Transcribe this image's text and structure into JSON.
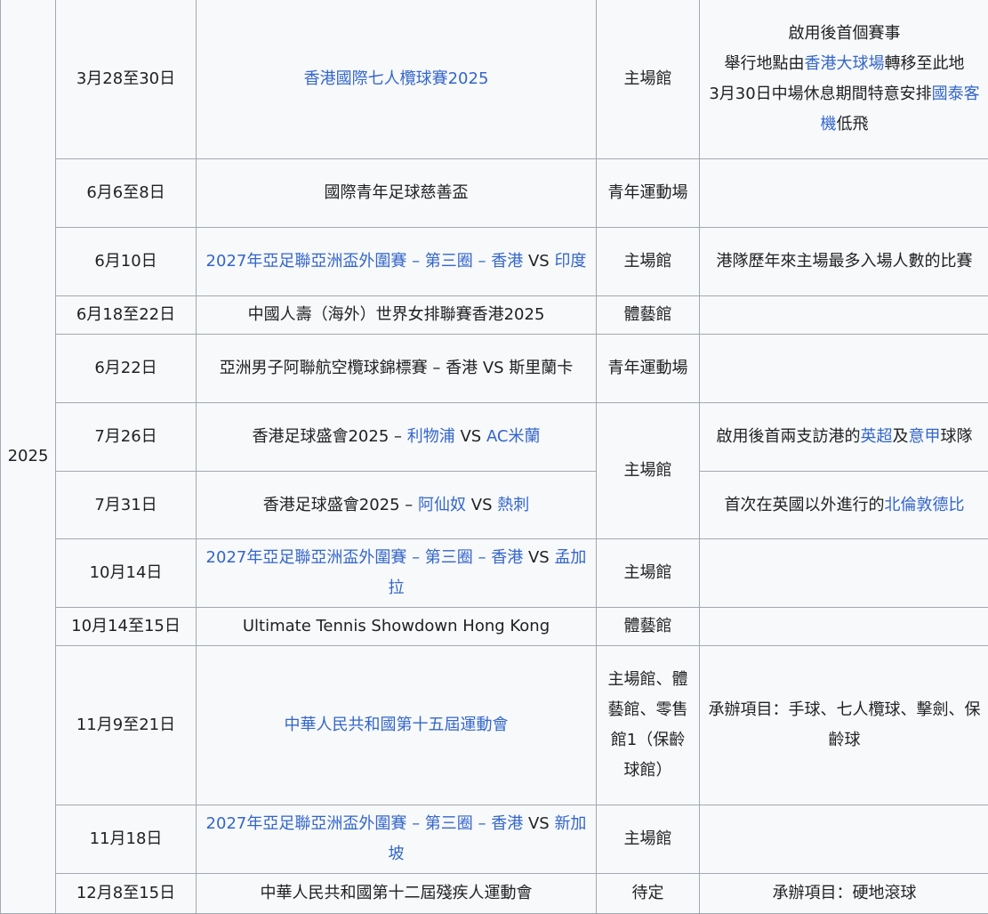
{
  "year": "2025",
  "rows": [
    {
      "date": "3月28至30日",
      "event": [
        {
          "t": "香港國際七人欖球賽2025",
          "link": true
        }
      ],
      "venue": "主場館",
      "notes": [
        {
          "t": "啟用後首個賽事",
          "link": false
        },
        {
          "t": "",
          "br": true
        },
        {
          "t": "舉行地點由",
          "link": false
        },
        {
          "t": "香港大球場",
          "link": true
        },
        {
          "t": "轉移至此地",
          "link": false
        },
        {
          "t": "",
          "br": true
        },
        {
          "t": "3月30日中場休息期間特意安排",
          "link": false
        },
        {
          "t": "國泰客機",
          "link": true
        },
        {
          "t": "低飛",
          "link": false
        }
      ]
    },
    {
      "date": "6月6至8日",
      "event": [
        {
          "t": "國際青年足球慈善盃",
          "link": false
        }
      ],
      "venue": "青年運動場",
      "notes": []
    },
    {
      "date": "6月10日",
      "event": [
        {
          "t": "2027年亞足聯亞洲盃外圍賽 – 第三圈 – 香港",
          "link": true
        },
        {
          "t": " VS ",
          "link": false
        },
        {
          "t": "印度",
          "link": true
        }
      ],
      "venue": "主場館",
      "notes": [
        {
          "t": "港隊歷年來主場最多入場人數的比賽",
          "link": false
        }
      ]
    },
    {
      "date": "6月18至22日",
      "event": [
        {
          "t": "中國人壽（海外）世界女排聯賽香港2025",
          "link": false
        }
      ],
      "venue": "體藝館",
      "notes": []
    },
    {
      "date": "6月22日",
      "event": [
        {
          "t": "亞洲男子阿聯航空欖球錦標賽 – 香港 VS 斯里蘭卡",
          "link": false
        }
      ],
      "venue": "青年運動場",
      "notes": []
    },
    {
      "date": "7月26日",
      "event": [
        {
          "t": "香港足球盛會2025 – ",
          "link": false
        },
        {
          "t": "利物浦",
          "link": true
        },
        {
          "t": " VS ",
          "link": false
        },
        {
          "t": "AC米蘭",
          "link": true
        }
      ],
      "venue": "主場館",
      "notes": [
        {
          "t": "啟用後首兩支訪港的",
          "link": false
        },
        {
          "t": "英超",
          "link": true
        },
        {
          "t": "及",
          "link": false
        },
        {
          "t": "意甲",
          "link": true
        },
        {
          "t": "球隊",
          "link": false
        }
      ]
    },
    {
      "date": "7月31日",
      "event": [
        {
          "t": "香港足球盛會2025 – ",
          "link": false
        },
        {
          "t": "阿仙奴",
          "link": true
        },
        {
          "t": " VS ",
          "link": false
        },
        {
          "t": "熱刺",
          "link": true
        }
      ],
      "venue": "",
      "notes": [
        {
          "t": "首次在英國以外進行的",
          "link": false
        },
        {
          "t": "北倫敦德比",
          "link": true
        }
      ]
    },
    {
      "date": "10月14日",
      "event": [
        {
          "t": "2027年亞足聯亞洲盃外圍賽 – 第三圈 – 香港",
          "link": true
        },
        {
          "t": " VS ",
          "link": false
        },
        {
          "t": "孟加拉",
          "link": true
        }
      ],
      "venue": "主場館",
      "notes": []
    },
    {
      "date": "10月14至15日",
      "event": [
        {
          "t": "Ultimate Tennis Showdown Hong Kong",
          "link": false
        }
      ],
      "venue": "體藝館",
      "notes": []
    },
    {
      "date": "11月9至21日",
      "event": [
        {
          "t": "中華人民共和國第十五屆運動會",
          "link": true
        }
      ],
      "venue": "主場館、體藝館、零售館1（保齡球館）",
      "notes": [
        {
          "t": "承辦項目：手球、七人欖球、擊劍、保齡球",
          "link": false
        }
      ]
    },
    {
      "date": "11月18日",
      "event": [
        {
          "t": "2027年亞足聯亞洲盃外圍賽 – 第三圈 – 香港",
          "link": true
        },
        {
          "t": " VS ",
          "link": false
        },
        {
          "t": "新加坡",
          "link": true
        }
      ],
      "venue": "主場館",
      "notes": []
    },
    {
      "date": "12月8至15日",
      "event": [
        {
          "t": "中華人民共和國第十二屆殘疾人運動會",
          "link": false
        }
      ],
      "venue": "待定",
      "notes": [
        {
          "t": "承辦項目：硬地滾球",
          "link": false
        }
      ]
    }
  ]
}
